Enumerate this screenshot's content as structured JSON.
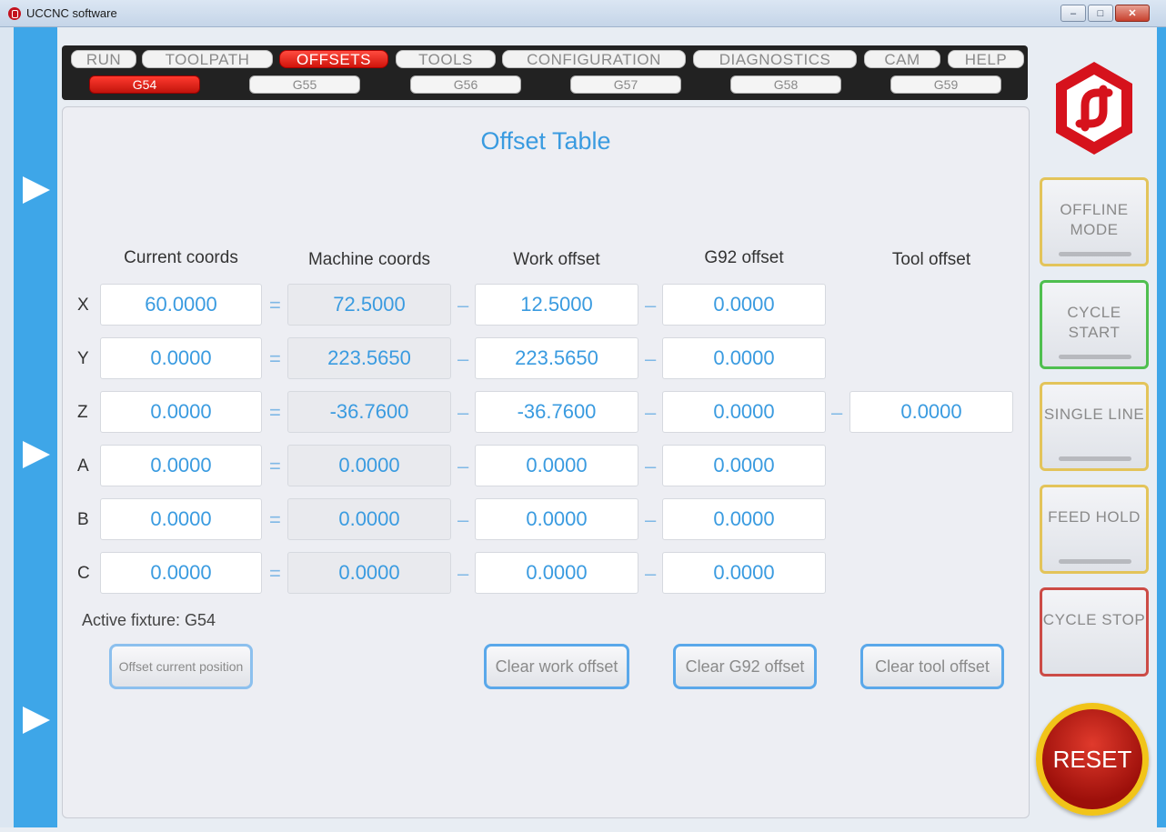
{
  "window": {
    "title": "UCCNC software"
  },
  "tabs": [
    "RUN",
    "TOOLPATH",
    "OFFSETS",
    "TOOLS",
    "CONFIGURATION",
    "DIAGNOSTICS",
    "CAM",
    "HELP"
  ],
  "active_tab": "OFFSETS",
  "subtabs": [
    "G54",
    "G55",
    "G56",
    "G57",
    "G58",
    "G59"
  ],
  "active_subtab": "G54",
  "main": {
    "title": "Offset Table",
    "columns": [
      "Current coords",
      "Machine coords",
      "Work offset",
      "G92 offset",
      "Tool offset"
    ],
    "rows": [
      {
        "axis": "X",
        "current": "60.0000",
        "machine": "72.5000",
        "work": "12.5000",
        "g92": "0.0000"
      },
      {
        "axis": "Y",
        "current": "0.0000",
        "machine": "223.5650",
        "work": "223.5650",
        "g92": "0.0000"
      },
      {
        "axis": "Z",
        "current": "0.0000",
        "machine": "-36.7600",
        "work": "-36.7600",
        "g92": "0.0000",
        "tool": "0.0000"
      },
      {
        "axis": "A",
        "current": "0.0000",
        "machine": "0.0000",
        "work": "0.0000",
        "g92": "0.0000"
      },
      {
        "axis": "B",
        "current": "0.0000",
        "machine": "0.0000",
        "work": "0.0000",
        "g92": "0.0000"
      },
      {
        "axis": "C",
        "current": "0.0000",
        "machine": "0.0000",
        "work": "0.0000",
        "g92": "0.0000"
      }
    ],
    "eq": "=",
    "minus": "–",
    "active_fixture": "Active fixture: G54",
    "buttons": {
      "offset_current": "Offset current position",
      "clear_work": "Clear work offset",
      "clear_g92": "Clear G92 offset",
      "clear_tool": "Clear tool offset"
    }
  },
  "side": {
    "offline_mode": "OFFLINE MODE",
    "cycle_start": "CYCLE START",
    "single_line": "SINGLE LINE",
    "feed_hold": "FEED HOLD",
    "cycle_stop": "CYCLE STOP",
    "reset": "RESET"
  },
  "colors": {
    "accent": "#3a9be0",
    "strip": "#3ea6e8",
    "red": "#d0140b",
    "reset_ring": "#f1c419"
  }
}
